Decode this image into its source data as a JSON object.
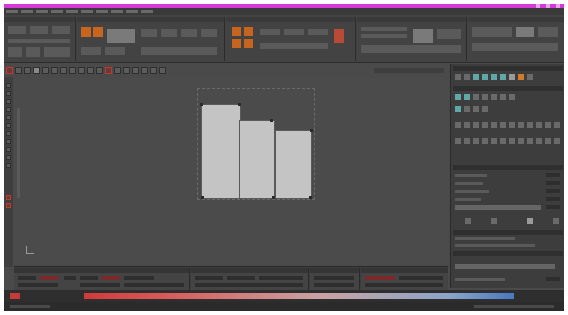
{
  "window": {
    "title": ""
  },
  "menubar": {
    "items": []
  },
  "ribbon": {
    "groups": []
  },
  "toolbar": {},
  "viewport": {},
  "right_panel": {},
  "bottom_panel": {},
  "timeline": {},
  "colors": {
    "titlebar": "#d43ad8",
    "app_background": "#4a4a4a",
    "shape_fill": "#c4c4c4",
    "accent_orange": "#c7641e",
    "accent_teal": "#5fa8a8"
  }
}
